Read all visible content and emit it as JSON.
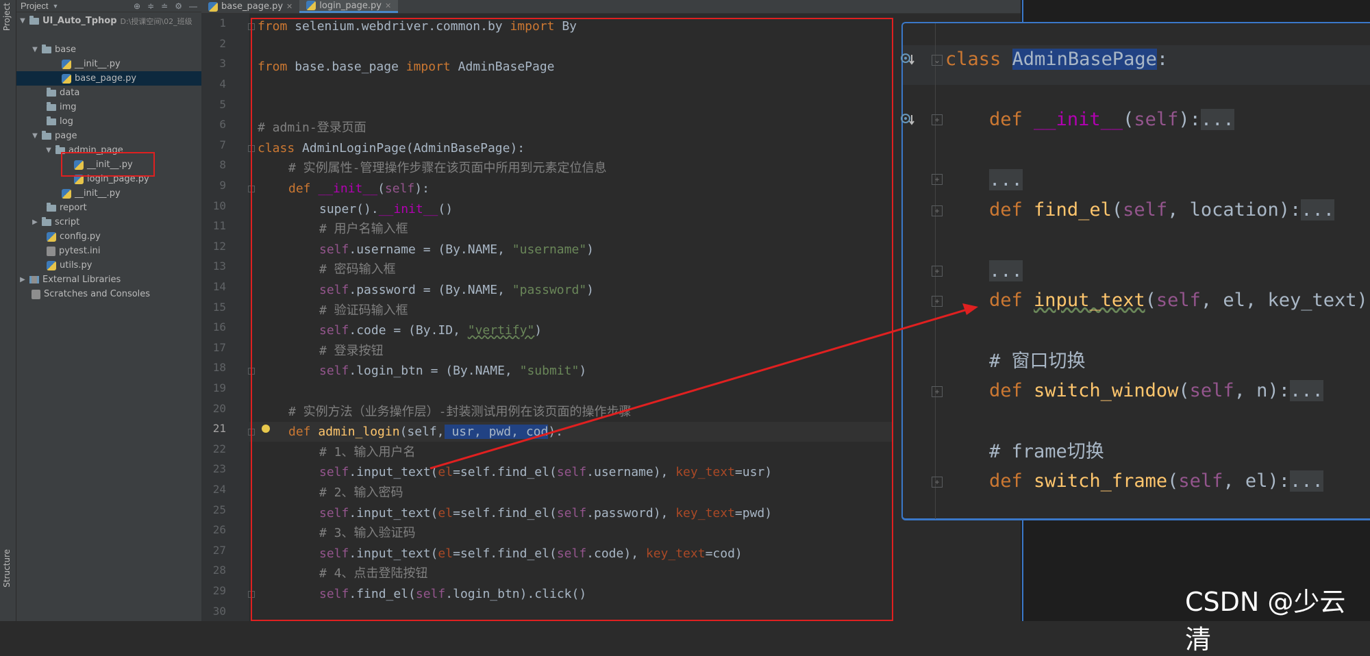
{
  "sidebar_tabs": {
    "project": "Project",
    "structure": "Structure"
  },
  "project_panel": {
    "header_label": "Project",
    "root_name": "UI_Auto_Tphop",
    "root_path": "D:\\授课空间\\02_班级",
    "items": [
      {
        "label": "base"
      },
      {
        "label": "__init__.py"
      },
      {
        "label": "base_page.py"
      },
      {
        "label": "data"
      },
      {
        "label": "img"
      },
      {
        "label": "log"
      },
      {
        "label": "page"
      },
      {
        "label": "admin_page"
      },
      {
        "label": "__init__.py"
      },
      {
        "label": "login_page.py"
      },
      {
        "label": "__init__.py"
      },
      {
        "label": "report"
      },
      {
        "label": "script"
      },
      {
        "label": "config.py"
      },
      {
        "label": "pytest.ini"
      },
      {
        "label": "utils.py"
      },
      {
        "label": "External Libraries"
      },
      {
        "label": "Scratches and Consoles"
      }
    ]
  },
  "tabs": [
    {
      "label": "base_page.py"
    },
    {
      "label": "login_page.py"
    }
  ],
  "editor": {
    "line_numbers": [
      "1",
      "2",
      "3",
      "4",
      "5",
      "6",
      "7",
      "8",
      "9",
      "10",
      "11",
      "12",
      "13",
      "14",
      "15",
      "16",
      "17",
      "18",
      "19",
      "20",
      "21",
      "22",
      "23",
      "24",
      "25",
      "26",
      "27",
      "28",
      "29",
      "30"
    ],
    "t": {
      "from": "from",
      "sel_mod": " selenium.webdriver.common.by ",
      "import": "import",
      "by": " By",
      "base_mod": " base.base_page ",
      "abp": " AdminBasePage",
      "c6": "# admin-登录页面",
      "class": "class",
      "c7rest": " AdminLoginPage(AdminBasePage):",
      "c8": "# 实例属性-管理操作步骤在该页面中所用到元素定位信息",
      "def": "def",
      "init": "__init__",
      "self": "self",
      "l9b": "(",
      "l9c": "):",
      "super": "super().",
      "init2": "__init__",
      "l10c": "()",
      "c11": "# 用户名输入框",
      "username_a": ".username = (By.NAME, ",
      "username_s": "\"username\"",
      "close": ")",
      "c13": "# 密码输入框",
      "password_a": ".password = (By.NAME, ",
      "password_s": "\"password\"",
      "c15": "# 验证码输入框",
      "code_a": ".code = (By.ID, ",
      "code_s": "\"vertify\"",
      "c17": "# 登录按钮",
      "btn_a": ".login_btn = (By.NAME, ",
      "btn_s": "\"submit\"",
      "c20": "# 实例方法（业务操作层）-封装测试用例在该页面的操作步骤",
      "admin_login": "admin_login",
      "l21b": "(self,",
      "l21hl": " usr, pwd, cod",
      "l21c": "):",
      "c22": "# 1、输入用户名",
      "c24": "# 2、输入密码",
      "c26": "# 3、输入验证码",
      "c28": "# 4、点击登陆按钮",
      "it": ".input_text(",
      "el": "el",
      "eqself": "=self.find_el(",
      "user": ".username), ",
      "kt": "key_text",
      "eq_usr": "=usr)",
      "pass": ".password), ",
      "eq_pwd": "=pwd)",
      "code": ".code), ",
      "eq_cod": "=cod)",
      "findel": ".find_el(",
      "lb": ".login_btn).click()"
    }
  },
  "popup": {
    "class_kw": "class",
    "class_name": "AdminBasePage",
    "colon": ":",
    "def": "def",
    "init": "__init__",
    "self": "self",
    "init_tail": "):",
    "dots": "...",
    "find_el": "find_el",
    "find_el_args": ", location):",
    "input_text": "input_text",
    "input_text_args": ", el, key_text):",
    "comment_window": "# 窗口切换",
    "switch_window": "switch_window",
    "switch_window_args": ", n):",
    "comment_frame": "# frame切换",
    "switch_frame": "switch_frame",
    "switch_frame_args": ", el):",
    "paren": "("
  },
  "watermark": "CSDN @少云清",
  "colors": {
    "keyword": "#cc7832",
    "string": "#6a8759",
    "comment": "#808080",
    "self": "#94558d",
    "function": "#ffc66d",
    "dunder": "#b200b2",
    "param": "#aa4926",
    "annotation_red": "#e02020",
    "popup_border": "#3a78c9"
  }
}
